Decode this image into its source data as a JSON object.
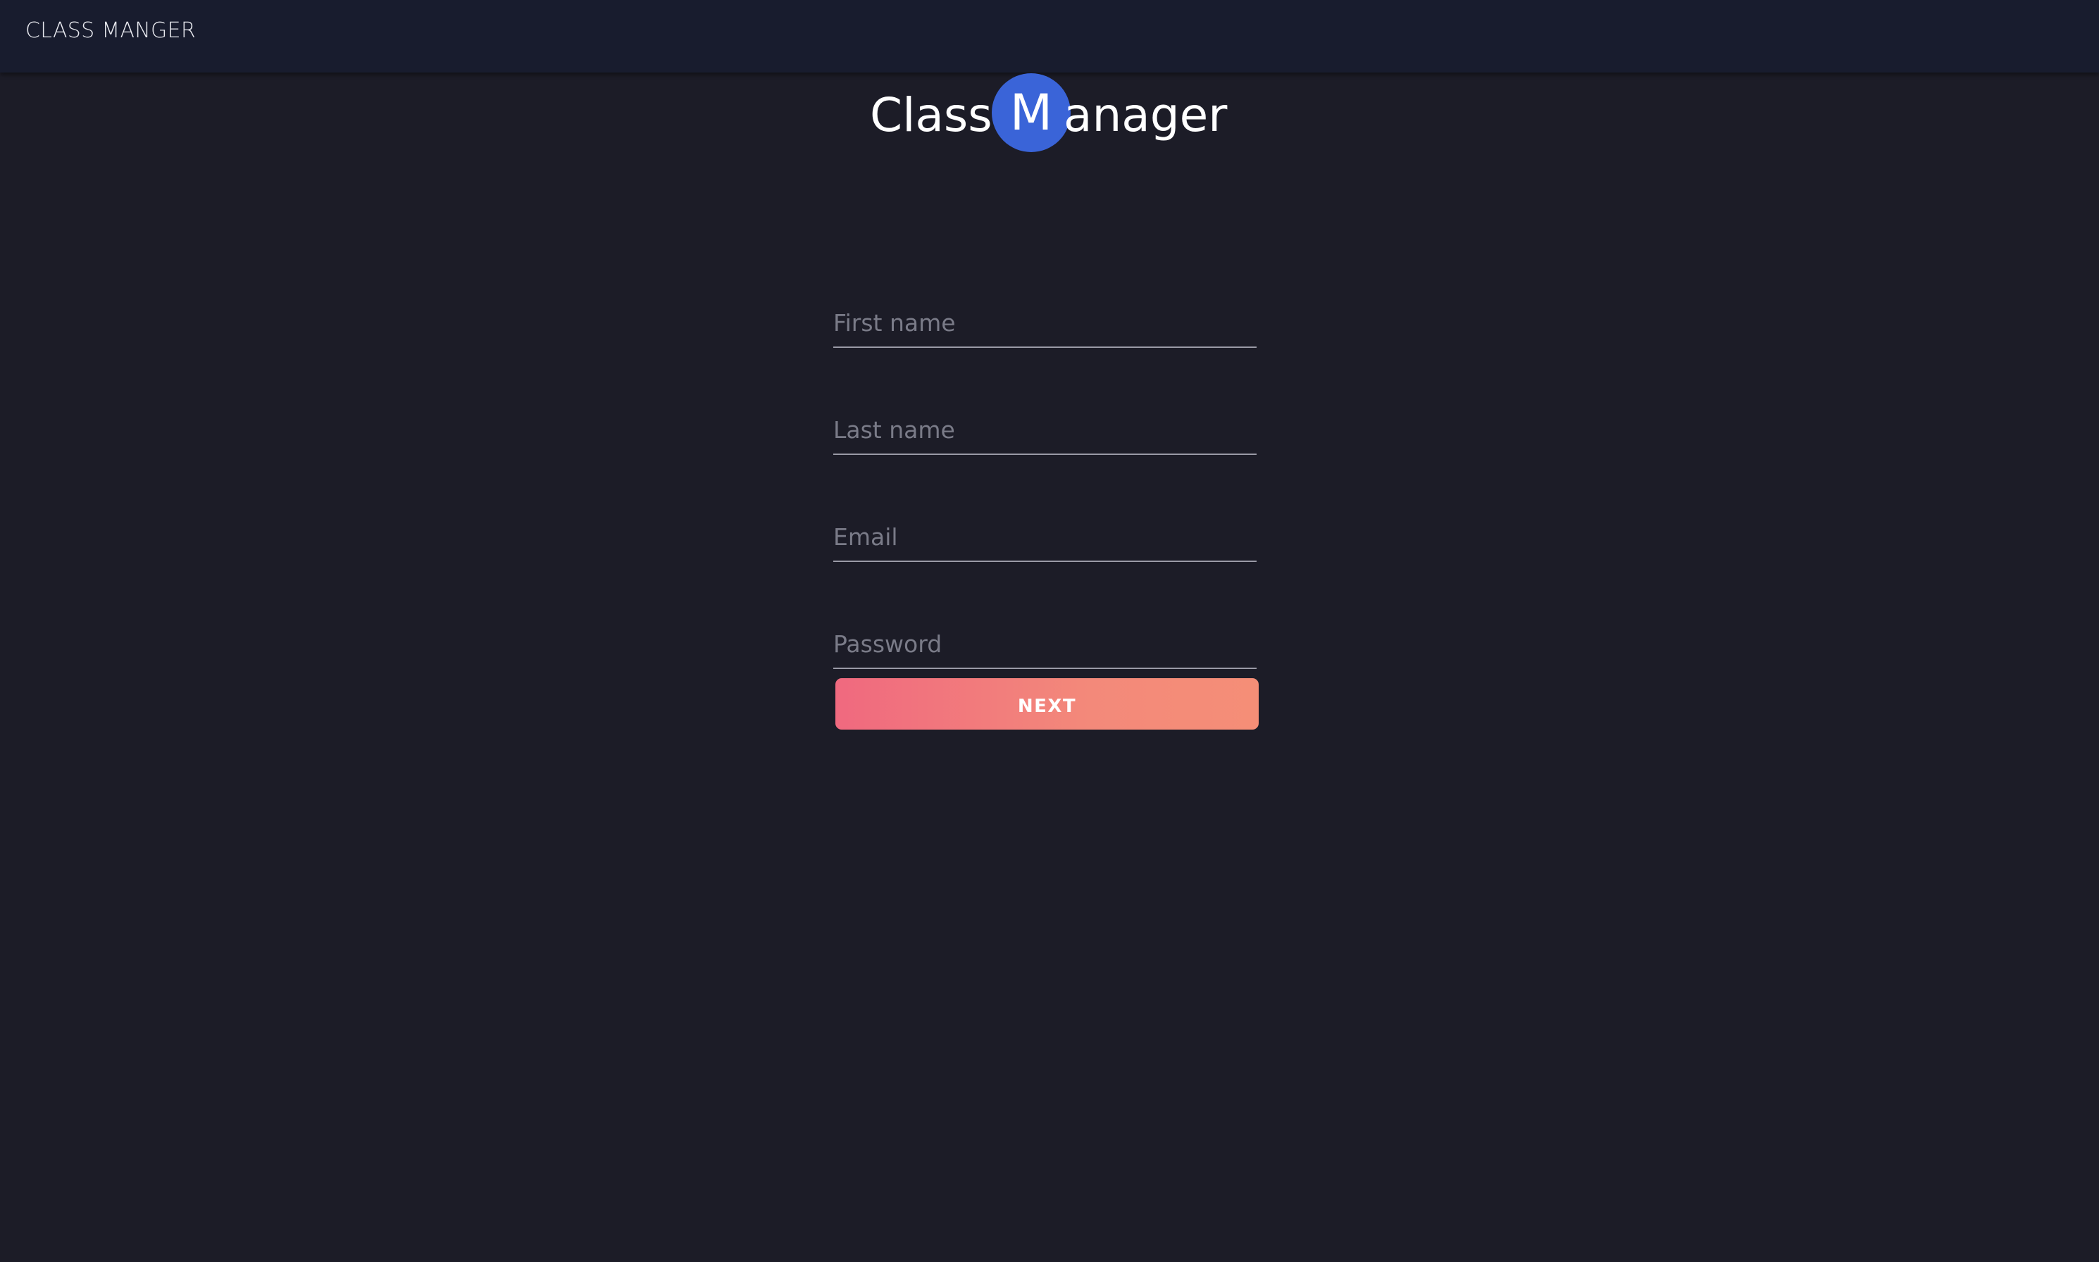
{
  "header": {
    "brand": "CLASS MANGER"
  },
  "logo": {
    "left_text": "Class",
    "circle_letter": "M",
    "right_text": "anager"
  },
  "form": {
    "first_name": {
      "placeholder": "First name",
      "value": ""
    },
    "last_name": {
      "placeholder": "Last name",
      "value": ""
    },
    "email": {
      "placeholder": "Email",
      "value": ""
    },
    "password": {
      "placeholder": "Password",
      "value": ""
    },
    "next_label": "NEXT"
  },
  "colors": {
    "page_background": "#1c1c27",
    "header_background": "#181c2e",
    "logo_circle": "#3a64d8",
    "button_gradient_start": "#f0697f",
    "button_gradient_end": "#f58e77"
  }
}
